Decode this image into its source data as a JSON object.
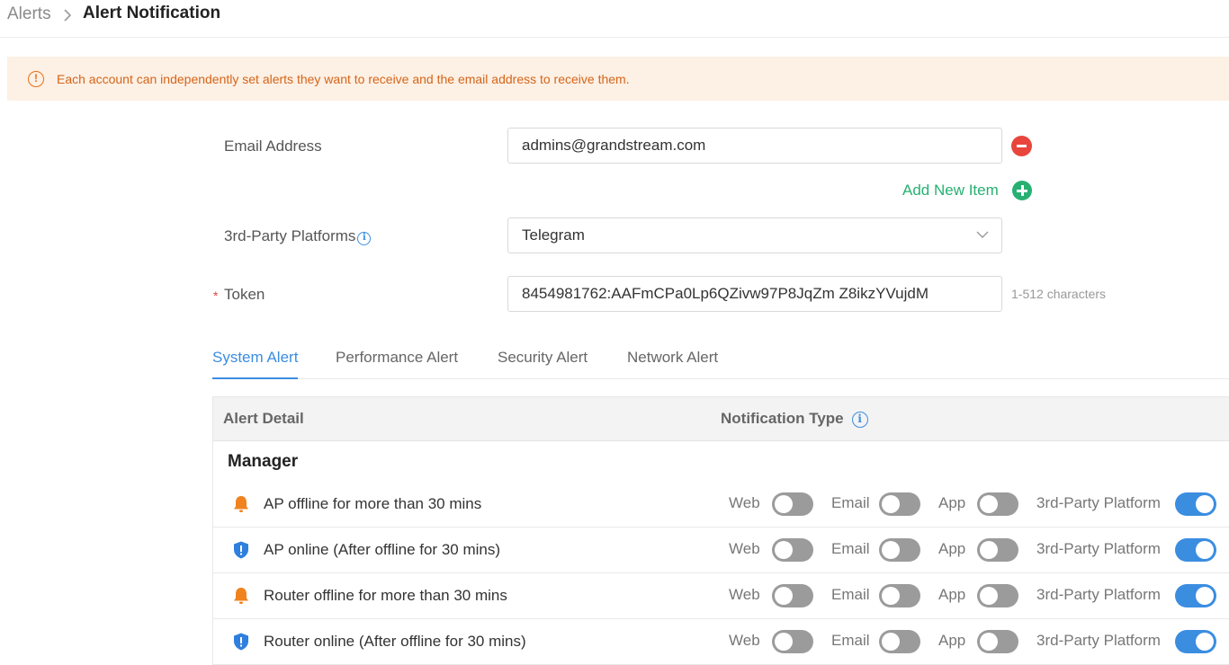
{
  "breadcrumb": {
    "root": "Alerts",
    "current": "Alert Notification"
  },
  "notice": {
    "text": "Each account can independently set alerts they want to receive and the email address to receive them."
  },
  "form": {
    "email_label": "Email Address",
    "email_value": "admins@grandstream.com",
    "add_new_item": "Add New Item",
    "platforms_label": "3rd-Party Platforms",
    "platforms_value": "Telegram",
    "token_required_mark": "*",
    "token_label": "Token",
    "token_value": "8454981762:AAFmCPa0Lp6QZivw97P8JqZm Z8ikzYVujdM",
    "token_hint": "1-512 characters"
  },
  "tabs": [
    {
      "label": "System Alert",
      "active": true
    },
    {
      "label": "Performance Alert",
      "active": false
    },
    {
      "label": "Security Alert",
      "active": false
    },
    {
      "label": "Network Alert",
      "active": false
    }
  ],
  "table": {
    "col_alert_detail": "Alert Detail",
    "col_notification_type": "Notification Type",
    "group": "Manager",
    "type_labels": {
      "web": "Web",
      "email": "Email",
      "app": "App",
      "third": "3rd-Party Platform"
    },
    "rows": [
      {
        "icon": "bell-icon",
        "text": "AP offline for more than 30 mins",
        "web": false,
        "email": false,
        "app": false,
        "third": true
      },
      {
        "icon": "shield-alert-icon",
        "text": "AP online (After offline for 30 mins)",
        "web": false,
        "email": false,
        "app": false,
        "third": true
      },
      {
        "icon": "bell-icon",
        "text": "Router offline for more than 30 mins",
        "web": false,
        "email": false,
        "app": false,
        "third": true
      },
      {
        "icon": "shield-alert-icon",
        "text": "Router online (After offline for 30 mins)",
        "web": false,
        "email": false,
        "app": false,
        "third": true
      }
    ]
  },
  "colors": {
    "accent": "#3b8de0",
    "warning": "#e8701a",
    "success": "#27b072",
    "danger": "#e8453c",
    "bell": "#f0831e"
  }
}
